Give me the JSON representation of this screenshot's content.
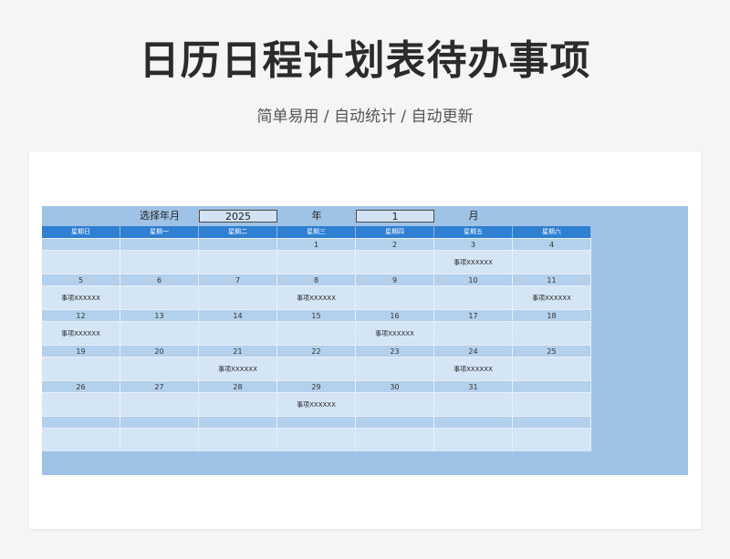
{
  "header": {
    "title": "日历日程计划表待办事项",
    "subtitle": "简单易用  /  自动统计  /  自动更新"
  },
  "controls": {
    "select_label": "选择年月",
    "year_value": "2025",
    "year_unit": "年",
    "month_value": "1",
    "month_unit": "月"
  },
  "calendar": {
    "weekdays": [
      "星期日",
      "星期一",
      "星期二",
      "星期三",
      "星期四",
      "星期五",
      "星期六"
    ],
    "weeks": [
      {
        "days": [
          "",
          "",
          "",
          "1",
          "2",
          "3",
          "4"
        ],
        "events": [
          "",
          "",
          "",
          "",
          "",
          "事项XXXXXX",
          ""
        ]
      },
      {
        "days": [
          "5",
          "6",
          "7",
          "8",
          "9",
          "10",
          "11"
        ],
        "events": [
          "事项XXXXXX",
          "",
          "",
          "事项XXXXXX",
          "",
          "",
          "事项XXXXXX"
        ]
      },
      {
        "days": [
          "12",
          "13",
          "14",
          "15",
          "16",
          "17",
          "18"
        ],
        "events": [
          "事项XXXXXX",
          "",
          "",
          "",
          "事项XXXXXX",
          "",
          ""
        ]
      },
      {
        "days": [
          "19",
          "20",
          "21",
          "22",
          "23",
          "24",
          "25"
        ],
        "events": [
          "",
          "",
          "事项XXXXXX",
          "",
          "",
          "事项XXXXXX",
          ""
        ]
      },
      {
        "days": [
          "26",
          "27",
          "28",
          "29",
          "30",
          "31",
          ""
        ],
        "events": [
          "",
          "",
          "",
          "事项XXXXXX",
          "",
          "",
          ""
        ]
      },
      {
        "days": [
          "",
          "",
          "",
          "",
          "",
          "",
          ""
        ],
        "events": [
          "",
          "",
          "",
          "",
          "",
          "",
          ""
        ]
      }
    ]
  },
  "colors": {
    "header_blue": "#2f7fd3",
    "panel_blue": "#9fc3e6",
    "day_row": "#b3d0ec",
    "event_row": "#d4e5f6"
  }
}
